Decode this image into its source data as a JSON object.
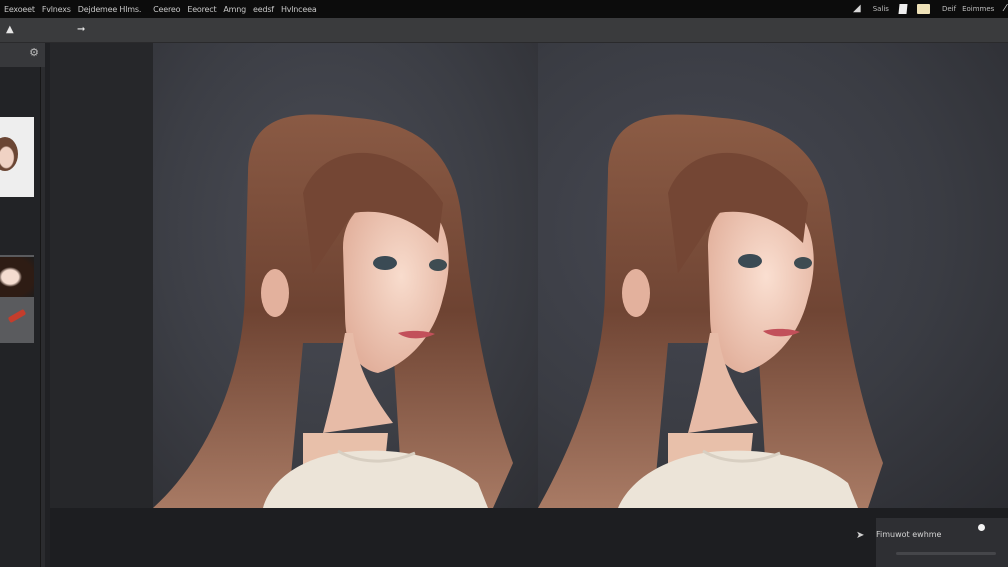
{
  "menubar": {
    "items": [
      "Eexoeet",
      "Fvlnexs",
      "Dejdemee Hlms.",
      "Ceereo",
      "Eeorect",
      "Amng",
      "eedsf",
      "Hvlnceea"
    ],
    "right_text_1": "Salis",
    "right_text_2": "Deif",
    "right_text_3": "Eoimmes",
    "icons": [
      "crop-icon",
      "document-icon",
      "color-swatch-icon",
      "pen-icon"
    ],
    "swatch_color": "#efe2b8"
  },
  "toolbar": {
    "icons": [
      "home-icon",
      "brush-icon"
    ]
  },
  "bottom_panel": {
    "label": "Fimuwot ewhme"
  },
  "colors": {
    "background": "#202124",
    "hair_brown": "#7a4c38",
    "skin": "#f0cbb8",
    "sweater": "#ece4d8"
  }
}
